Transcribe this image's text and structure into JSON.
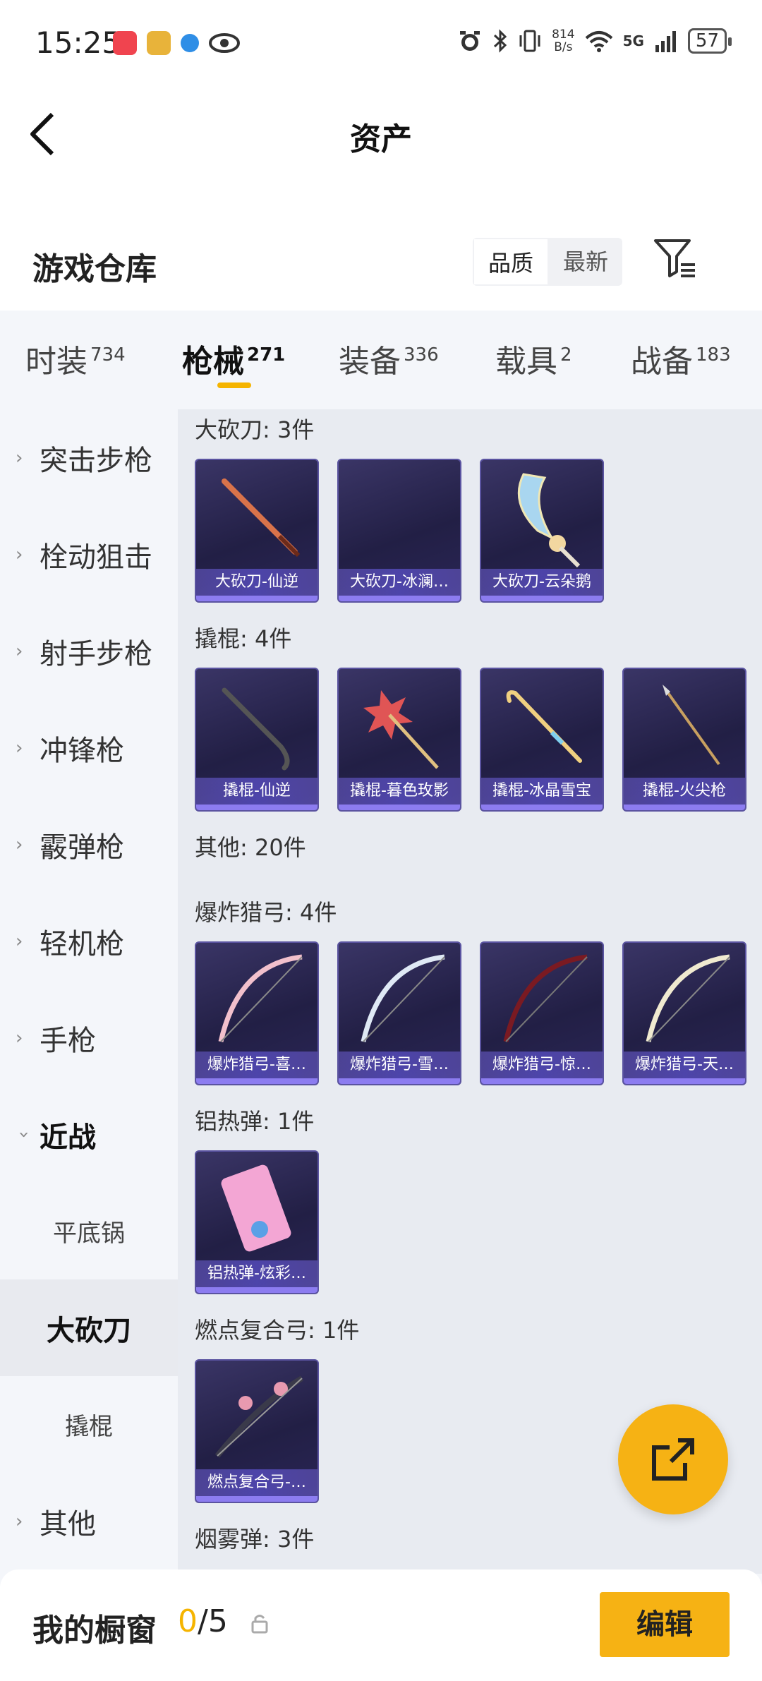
{
  "status_bar": {
    "time": "15:25",
    "net_speed_value": "814",
    "net_speed_unit": "B/s",
    "network": "5G",
    "battery": "57"
  },
  "header": {
    "title": "资产"
  },
  "warehouse": {
    "title": "游戏仓库",
    "sort_options": [
      "品质",
      "最新"
    ],
    "sort_selected": "品质"
  },
  "tabs": [
    {
      "label": "时装",
      "count": "734"
    },
    {
      "label": "枪械",
      "count": "271"
    },
    {
      "label": "装备",
      "count": "336"
    },
    {
      "label": "载具",
      "count": "2"
    },
    {
      "label": "战备",
      "count": "183"
    }
  ],
  "active_tab": "枪械",
  "sidebar": {
    "items": [
      {
        "label": "突击步枪"
      },
      {
        "label": "栓动狙击"
      },
      {
        "label": "射手步枪"
      },
      {
        "label": "冲锋枪"
      },
      {
        "label": "霰弹枪"
      },
      {
        "label": "轻机枪"
      },
      {
        "label": "手枪"
      },
      {
        "label": "近战"
      }
    ],
    "sub_items": [
      {
        "label": "平底锅"
      },
      {
        "label": "大砍刀"
      },
      {
        "label": "撬棍"
      }
    ],
    "other": "其他",
    "active_sub": "大砍刀"
  },
  "content": {
    "sections": [
      {
        "title": "大砍刀: 3件",
        "items": [
          "大砍刀-仙逆",
          "大砍刀-冰澜…",
          "大砍刀-云朵鹅"
        ]
      },
      {
        "title": "撬棍: 4件",
        "items": [
          "撬棍-仙逆",
          "撬棍-暮色玫影",
          "撬棍-冰晶雪宝",
          "撬棍-火尖枪"
        ]
      },
      {
        "title": "其他: 20件",
        "items": []
      },
      {
        "title": "爆炸猎弓: 4件",
        "items": [
          "爆炸猎弓-喜…",
          "爆炸猎弓-雪…",
          "爆炸猎弓-惊…",
          "爆炸猎弓-天…"
        ]
      },
      {
        "title": "铝热弹: 1件",
        "items": [
          "铝热弹-炫彩…"
        ]
      },
      {
        "title": "燃点复合弓: 1件",
        "items": [
          "燃点复合弓-…"
        ]
      },
      {
        "title": "烟雾弹: 3件",
        "items": []
      }
    ]
  },
  "bottom_bar": {
    "title": "我的橱窗",
    "count_current": "0",
    "count_total": "/5",
    "edit_label": "编辑"
  },
  "colors": {
    "accent": "#f6b214",
    "card_bg": "#221f45",
    "card_bar": "#8c7cf0"
  }
}
